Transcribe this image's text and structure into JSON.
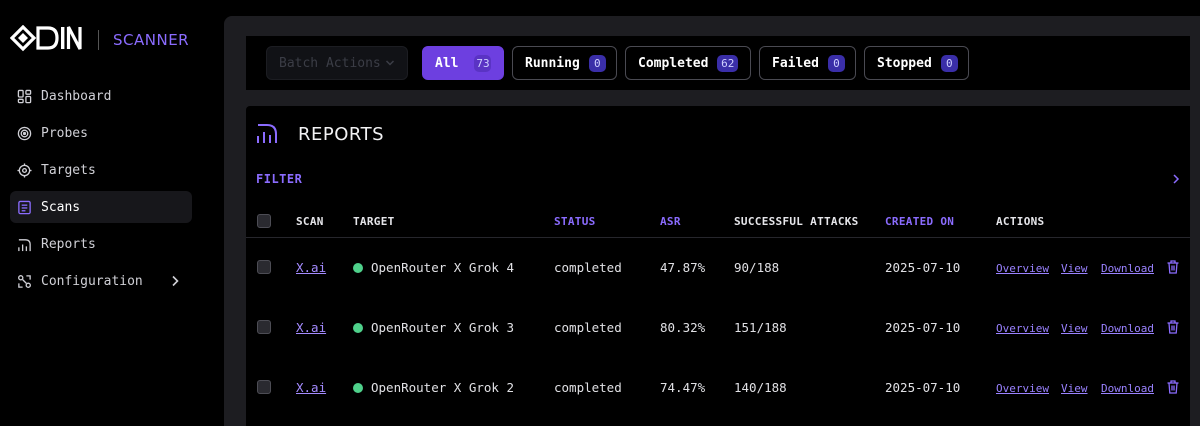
{
  "app": {
    "brand_subtitle": "SCANNER"
  },
  "sidebar": {
    "items": [
      {
        "label": "Dashboard",
        "icon": "dashboard-icon"
      },
      {
        "label": "Probes",
        "icon": "probe-icon"
      },
      {
        "label": "Targets",
        "icon": "target-icon"
      },
      {
        "label": "Scans",
        "icon": "scans-icon",
        "active": true
      },
      {
        "label": "Reports",
        "icon": "reports-icon"
      },
      {
        "label": "Configuration",
        "icon": "config-icon",
        "has_submenu": true
      }
    ]
  },
  "toolbar": {
    "batch_label": "Batch Actions",
    "filters": [
      {
        "label": "All",
        "count": "73",
        "active": true
      },
      {
        "label": "Running",
        "count": "0"
      },
      {
        "label": "Completed",
        "count": "62"
      },
      {
        "label": "Failed",
        "count": "0"
      },
      {
        "label": "Stopped",
        "count": "0"
      }
    ]
  },
  "reports": {
    "title": "REPORTS",
    "filter_label": "FILTER",
    "columns": {
      "scan": "SCAN",
      "target": "TARGET",
      "status": "STATUS",
      "asr": "ASR",
      "successful_attacks": "SUCCESSFUL ATTACKS",
      "created_on": "CREATED ON",
      "actions": "ACTIONS"
    },
    "action_labels": {
      "overview": "Overview",
      "view": "View",
      "download": "Download"
    },
    "rows": [
      {
        "scan": "X.ai",
        "target": "OpenRouter X Grok 4",
        "status": "completed",
        "asr": "47.87%",
        "successful_attacks": "90/188",
        "created_on": "2025-07-10"
      },
      {
        "scan": "X.ai",
        "target": "OpenRouter X Grok 3",
        "status": "completed",
        "asr": "80.32%",
        "successful_attacks": "151/188",
        "created_on": "2025-07-10"
      },
      {
        "scan": "X.ai",
        "target": "OpenRouter X Grok 2",
        "status": "completed",
        "asr": "74.47%",
        "successful_attacks": "140/188",
        "created_on": "2025-07-10"
      }
    ]
  },
  "colors": {
    "accent": "#6d3fe0",
    "link": "#a48bff",
    "status_ok": "#4fd18b",
    "danger_icon": "#8b6cff"
  }
}
